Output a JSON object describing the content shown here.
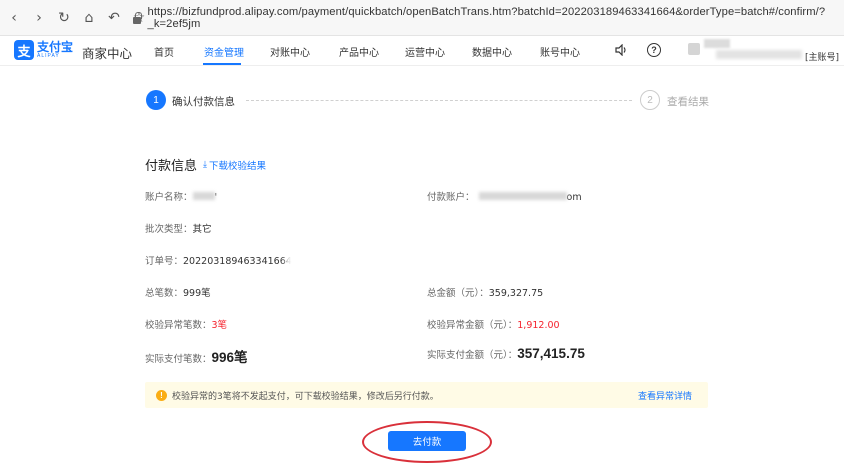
{
  "browser": {
    "url": "https://bizfundprod.alipay.com/payment/quickbatch/openBatchTrans.htm?batchId=2022031894633416​64&orderType=batch#/confirm/?_k=2ef5jm"
  },
  "header": {
    "logo_cn": "支付宝",
    "logo_en": "ALIPAY",
    "merchant_center": "商家中心",
    "nav": [
      {
        "label": "首页"
      },
      {
        "label": "资金管理",
        "active": true
      },
      {
        "label": "对账中心"
      },
      {
        "label": "产品中心"
      },
      {
        "label": "运营中心"
      },
      {
        "label": "数据中心"
      },
      {
        "label": "账号中心"
      }
    ],
    "account_type": "[主账号]"
  },
  "steps": [
    {
      "number": "1",
      "label": "确认付款信息",
      "active": true
    },
    {
      "number": "2",
      "label": "查看结果",
      "active": false
    }
  ],
  "payment_info": {
    "title": "付款信息",
    "download_link": "下载校验结果",
    "account_name_label": "账户名称：",
    "account_name_tail": "'",
    "payment_account_label": "付款账户：",
    "payment_account_tail": "om",
    "batch_type_label": "批次类型：",
    "batch_type_value": "其它",
    "order_no_label": "订单号：",
    "order_no_value": "2022031894633416​64",
    "total_count_label": "总笔数：",
    "total_count_value": "999笔",
    "total_amount_label": "总金额（元）：",
    "total_amount_value": "359,327.75",
    "abnormal_count_label": "校验异常笔数：",
    "abnormal_count_value": "3笔",
    "abnormal_amount_label": "校验异常金额（元）：",
    "abnormal_amount_value": "1,912.00",
    "actual_count_label": "实际支付笔数：",
    "actual_count_value": "996笔",
    "actual_amount_label": "实际支付金额（元）：",
    "actual_amount_value": "357,415.75"
  },
  "notice": {
    "text": "校验异常的3笔将不发起支付，可下载校验结果，修改后另行付款。",
    "link": "查看异常详情"
  },
  "actions": {
    "pay_button": "去付款"
  },
  "colors": {
    "primary": "#1677ff",
    "danger": "#f5222d",
    "warning_bg": "#fffbe6",
    "annotation": "#d9303a"
  }
}
